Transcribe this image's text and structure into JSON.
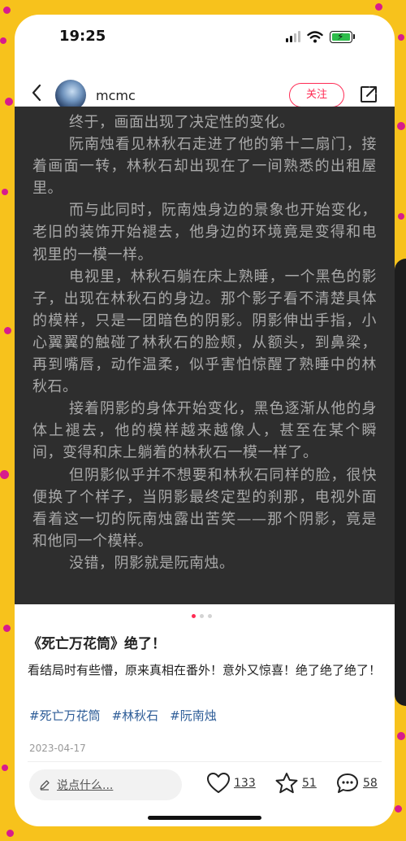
{
  "status_bar": {
    "time": "19:25"
  },
  "header": {
    "username": "mcmc",
    "follow_label": "关注"
  },
  "story": {
    "paragraphs": [
      "终于，画面出现了决定性的变化。",
      "阮南烛看见林秋石走进了他的第十二扇门，接着画面一转，林秋石却出现在了一间熟悉的出租屋里。",
      "而与此同时，阮南烛身边的景象也开始变化，老旧的装饰开始褪去，他身边的环境竟是变得和电视里的一模一样。",
      "电视里，林秋石躺在床上熟睡，一个黑色的影子，出现在林秋石的身边。那个影子看不清楚具体的模样，只是一团暗色的阴影。阴影伸出手指，小心翼翼的触碰了林秋石的脸颊，从额头，到鼻梁，再到嘴唇，动作温柔，似乎害怕惊醒了熟睡中的林秋石。",
      "接着阴影的身体开始变化，黑色逐渐从他的身体上褪去，他的模样越来越像人，甚至在某个瞬间，变得和床上躺着的林秋石一模一样了。",
      "但阴影似乎并不想要和林秋石同样的脸，很快便换了个样子，当阴影最终定型的刹那，电视外面看着这一切的阮南烛露出苦笑——那个阴影，竟是和他同一个模样。",
      "没错，阴影就是阮南烛。"
    ]
  },
  "post": {
    "title": "《死亡万花筒》绝了！",
    "description": "看结局时有些懵，原来真相在番外！意外又惊喜！绝了绝了绝了！",
    "tags": [
      "#死亡万花筒",
      "#林秋石",
      "#阮南烛"
    ],
    "date": "2023-04-17"
  },
  "bottom_bar": {
    "comment_placeholder": "说点什么...",
    "likes": "133",
    "favorites": "51",
    "comments": "58"
  },
  "colors": {
    "accent": "#ff2b54",
    "tag": "#2d5c97",
    "background": "#f7c21c"
  }
}
